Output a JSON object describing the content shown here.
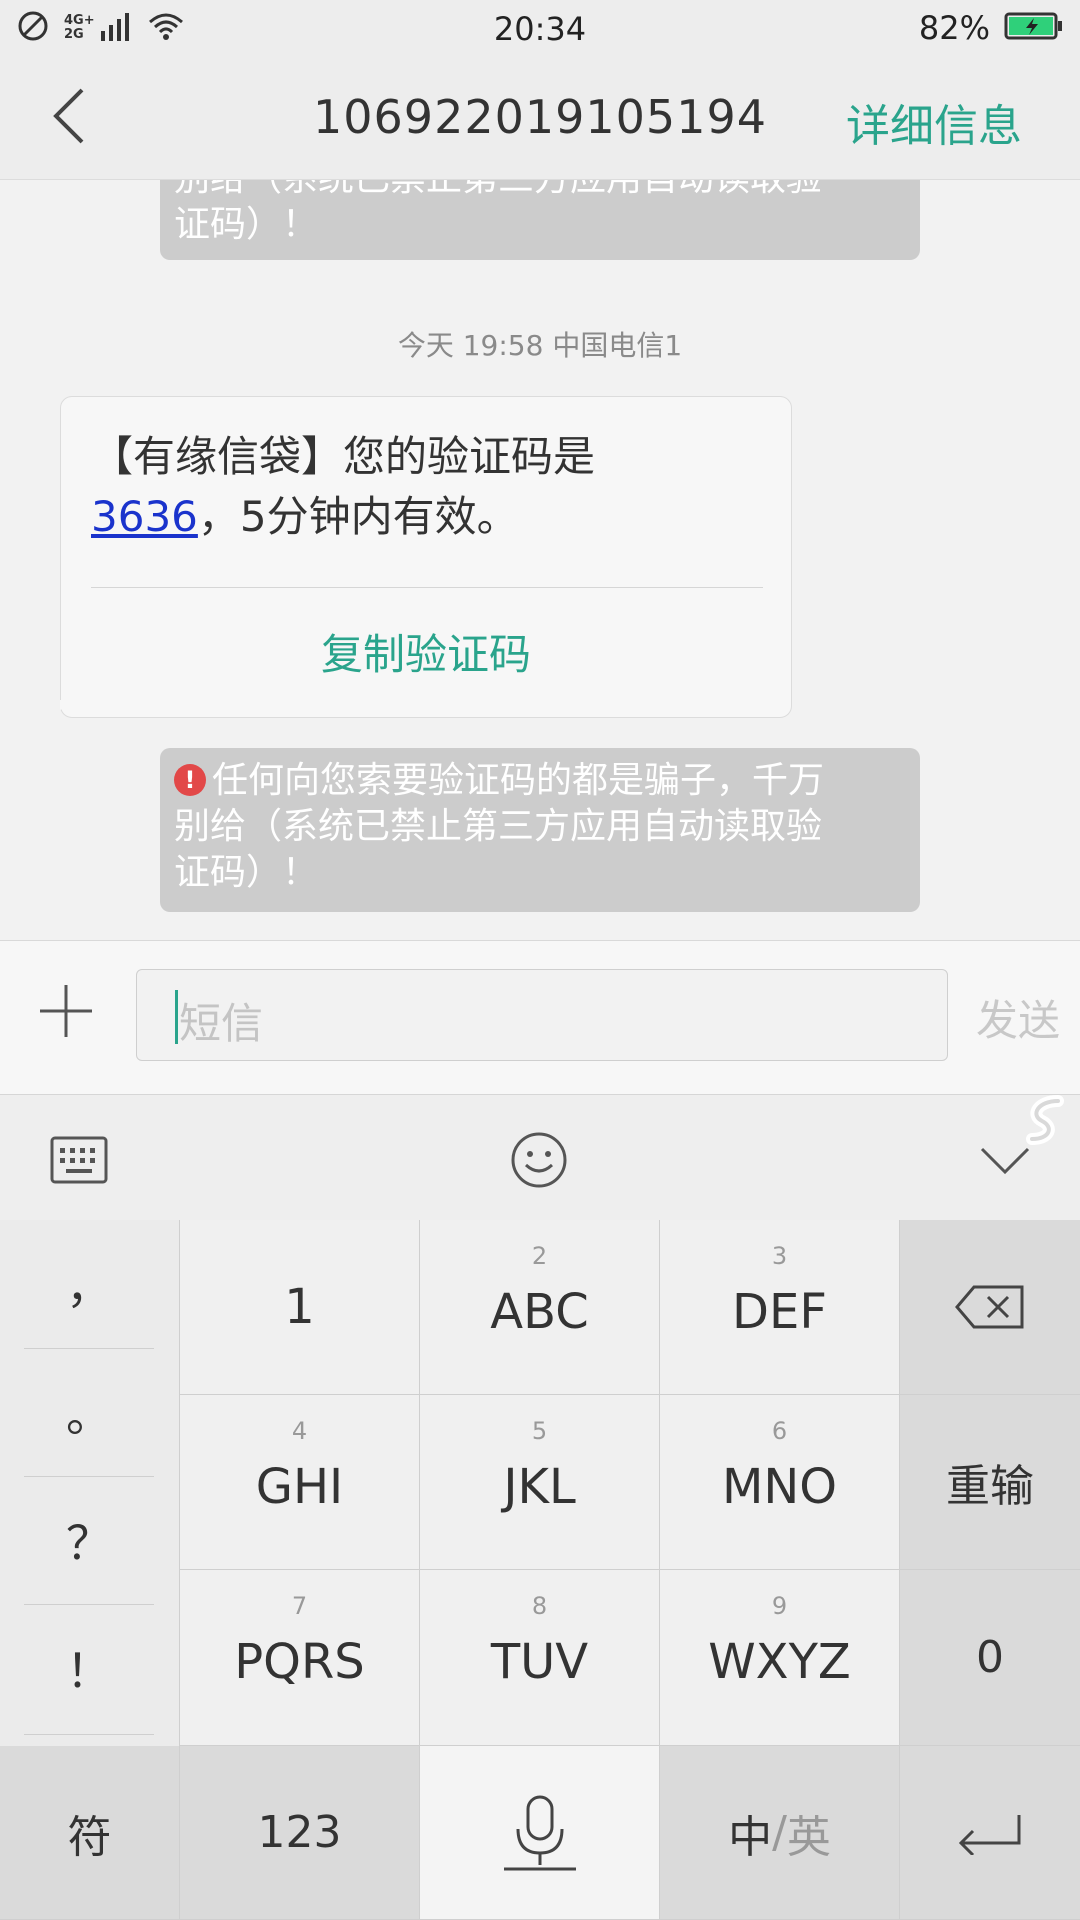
{
  "status_bar": {
    "network_top": "4G+",
    "network_bottom": "2G",
    "time": "20:34",
    "battery": "82%",
    "icons": [
      "no-disturb-icon",
      "signal-icon",
      "wifi-icon",
      "battery-charging-icon"
    ],
    "battery_color": "#2fd07a"
  },
  "header": {
    "title": "106922019105194",
    "detail_label": "详细信息",
    "back_icon": "chevron-left-icon"
  },
  "messages": {
    "notice_top_lines": [
      "别给（系统已禁止第三方应用自动读取验",
      "证码）！"
    ],
    "timestamp": "今天  19:58  中国电信1",
    "bubble": {
      "text_line1": "【有缘信袋】您的验证码是",
      "code": "3636",
      "text_line2_rest": "，5分钟内有效。",
      "copy_button": "复制验证码"
    },
    "notice_bottom": {
      "line1": "任何向您索要验证码的都是骗子，千万",
      "line2": "别给（系统已禁止第三方应用自动读取验",
      "line3": "证码）！"
    }
  },
  "input_bar": {
    "placeholder": "短信",
    "send_label": "发送"
  },
  "keyboard": {
    "toolbar_icons": [
      "keyboard-icon",
      "emoji-icon",
      "collapse-chevron-icon"
    ],
    "punctuation": [
      "，",
      "。",
      "？",
      "！"
    ],
    "keys": {
      "k1": {
        "label": "1"
      },
      "k2": {
        "num": "2",
        "label": "ABC"
      },
      "k3": {
        "num": "3",
        "label": "DEF"
      },
      "k4": {
        "num": "4",
        "label": "GHI"
      },
      "k5": {
        "num": "5",
        "label": "JKL"
      },
      "k6": {
        "num": "6",
        "label": "MNO"
      },
      "k7": {
        "num": "7",
        "label": "PQRS"
      },
      "k8": {
        "num": "8",
        "label": "TUV"
      },
      "k9": {
        "num": "9",
        "label": "WXYZ"
      },
      "reset": "重输",
      "zero": "0",
      "symbols": "符",
      "numbers": "123",
      "lang_zh": "中",
      "lang_sep": "/",
      "lang_en": "英"
    }
  },
  "accent_color": "#2aa48c"
}
